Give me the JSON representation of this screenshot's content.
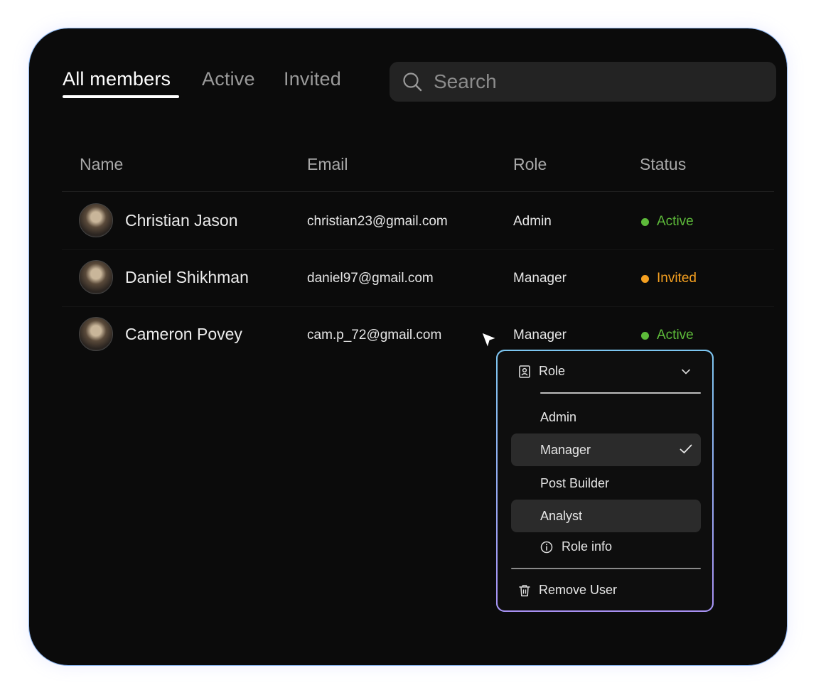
{
  "tabs": [
    {
      "label": "All members",
      "active": true
    },
    {
      "label": "Active",
      "active": false
    },
    {
      "label": "Invited",
      "active": false
    }
  ],
  "search": {
    "placeholder": "Search",
    "value": "",
    "icon": "search-icon"
  },
  "table": {
    "headers": [
      "Name",
      "Email",
      "Role",
      "Status"
    ],
    "rows": [
      {
        "name": "Christian Jason",
        "email": "christian23@gmail.com",
        "role": "Admin",
        "status": "Active",
        "status_color": "#5dba3a"
      },
      {
        "name": "Daniel Shikhman",
        "email": "daniel97@gmail.com",
        "role": "Manager",
        "status": "Invited",
        "status_color": "#f5a020"
      },
      {
        "name": "Cameron Povey",
        "email": "cam.p_72@gmail.com",
        "role": "Manager",
        "status": "Active",
        "status_color": "#5dba3a"
      }
    ]
  },
  "role_menu": {
    "title": "Role",
    "options": [
      {
        "label": "Admin",
        "selected": false
      },
      {
        "label": "Manager",
        "selected": true
      },
      {
        "label": "Post Builder",
        "selected": false
      },
      {
        "label": "Analyst",
        "selected": false
      }
    ],
    "role_info_label": "Role info",
    "remove_label": "Remove User"
  },
  "colors": {
    "background": "#0b0b0b",
    "active": "#5dba3a",
    "invited": "#f5a020",
    "border_accent": "#8fb8f0"
  }
}
